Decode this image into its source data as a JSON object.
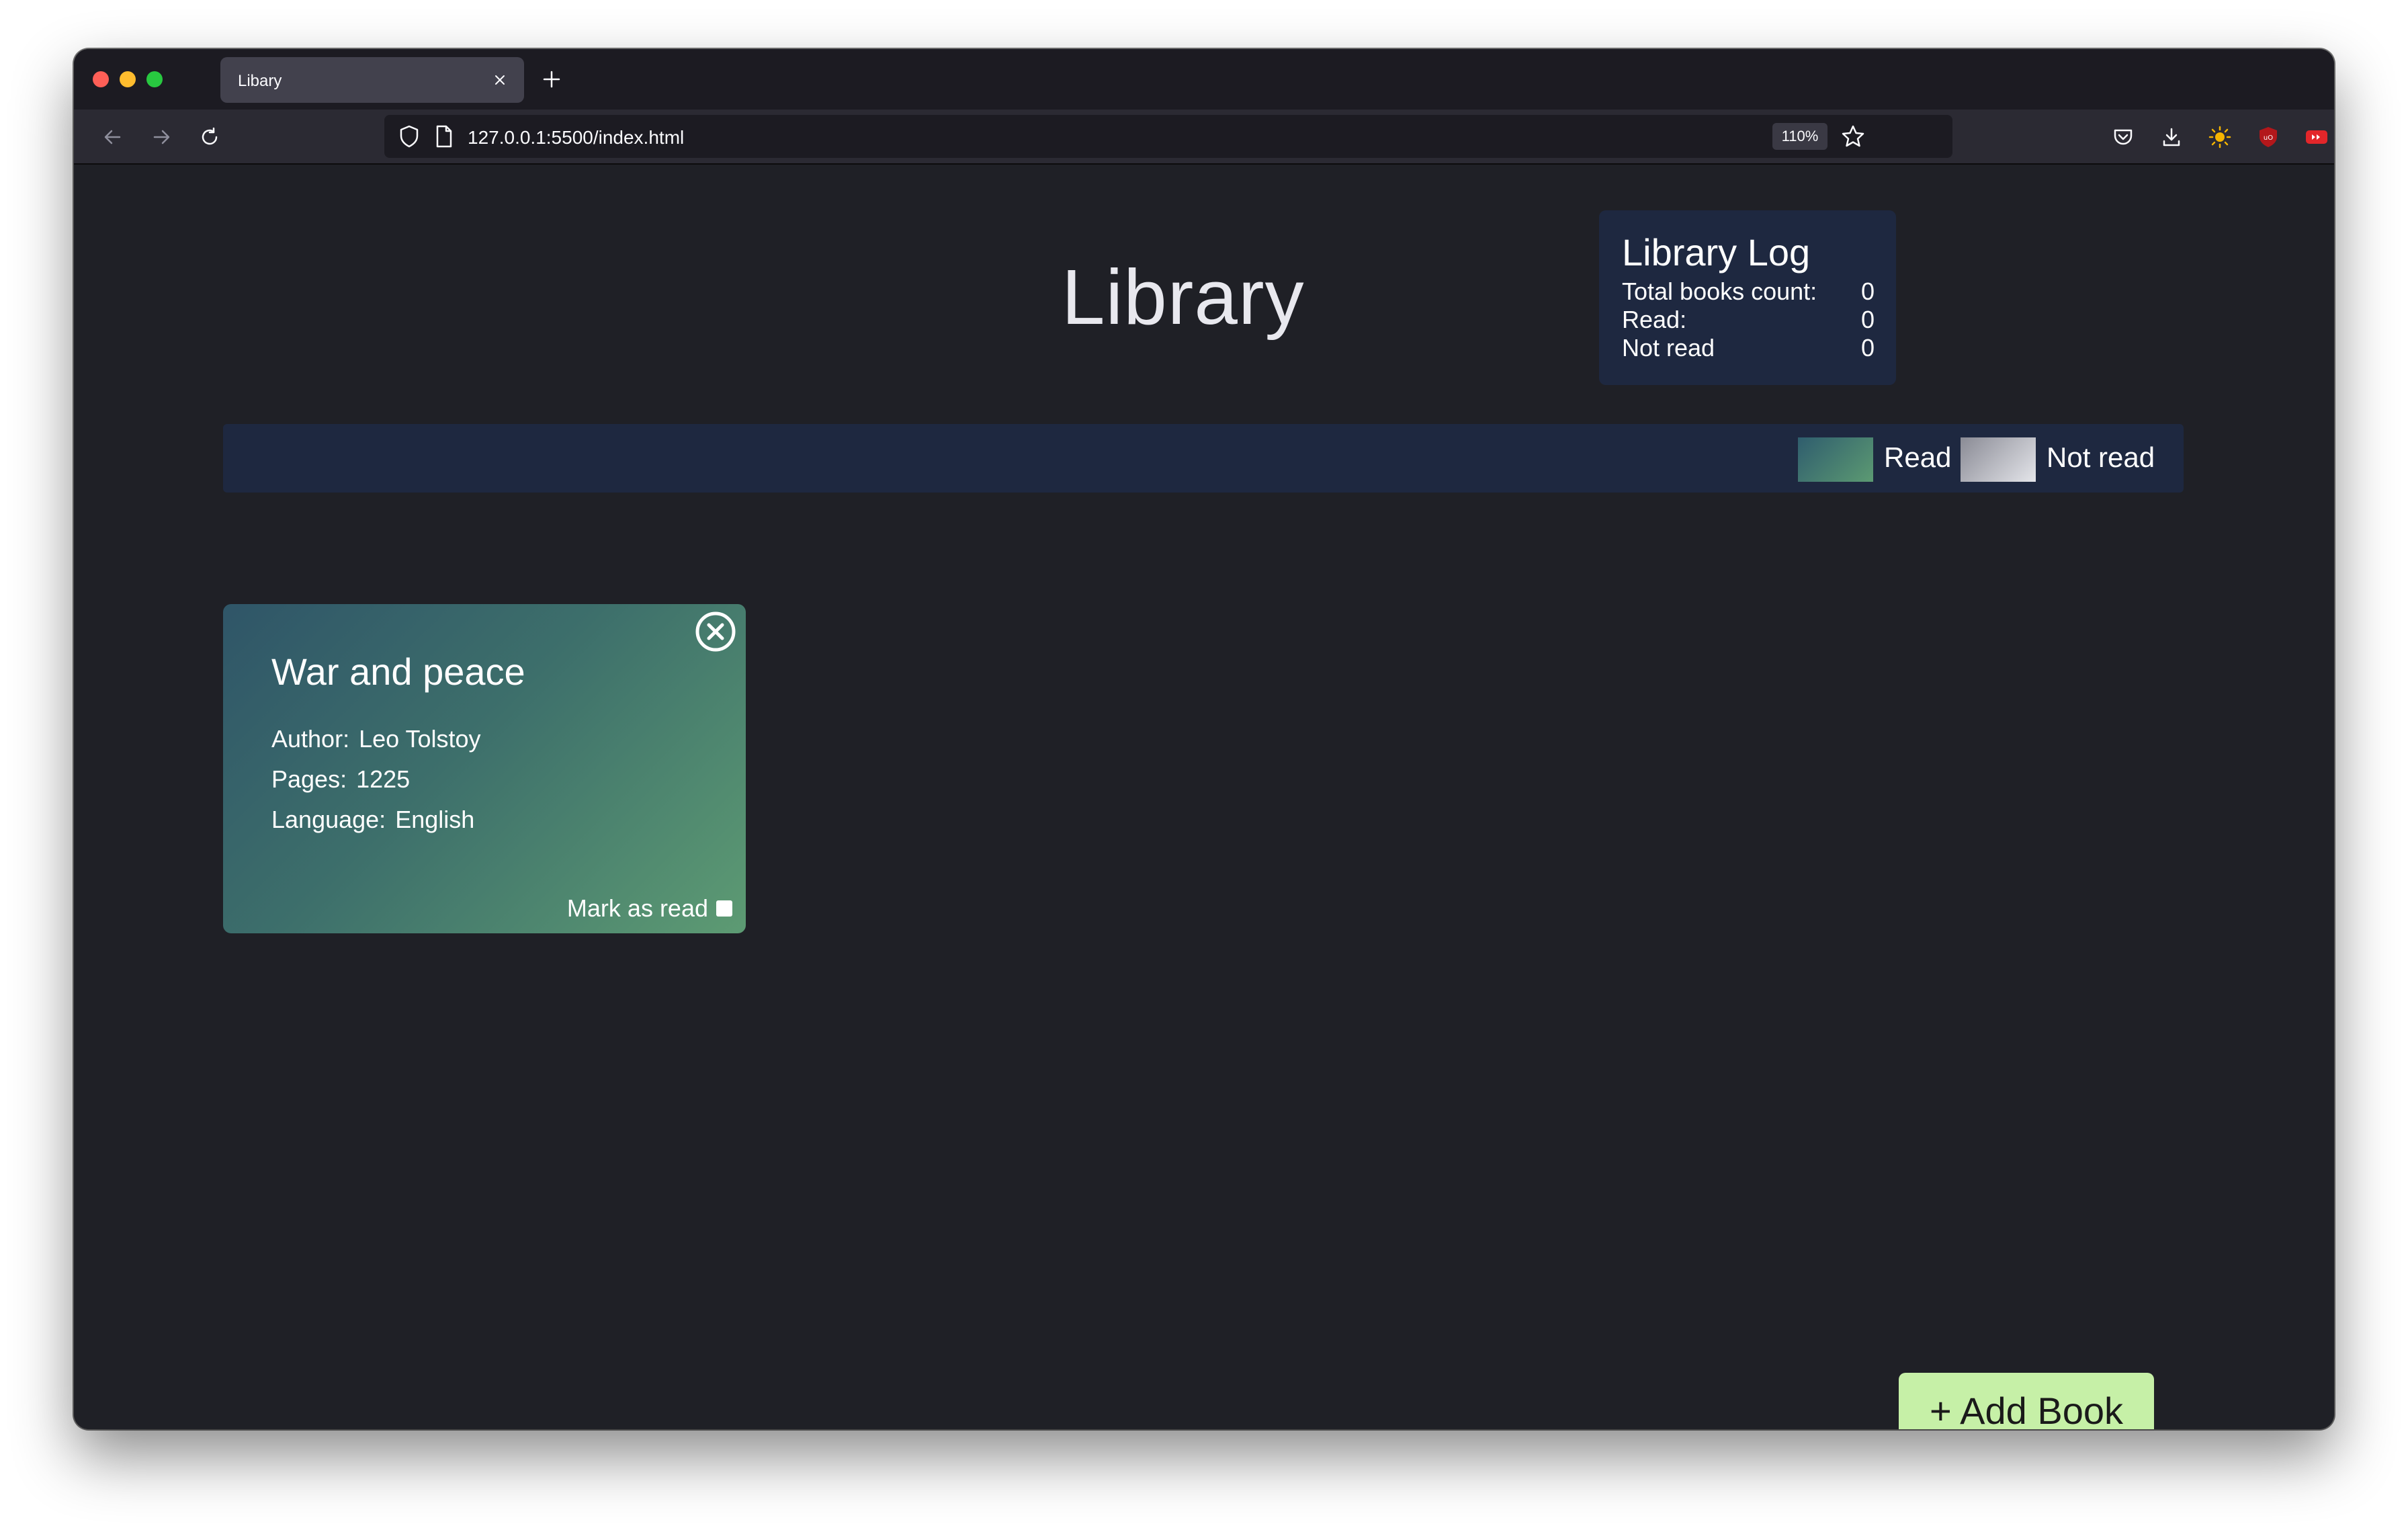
{
  "browser": {
    "tab_title": "Libary",
    "url": "127.0.0.1:5500/index.html",
    "zoom": "110%"
  },
  "page": {
    "title": "Library",
    "library_log": {
      "title": "Library Log",
      "rows": [
        {
          "label": "Total books count:",
          "value": "0"
        },
        {
          "label": "Read:",
          "value": "0"
        },
        {
          "label": "Not read",
          "value": "0"
        }
      ]
    },
    "legend": {
      "read_label": "Read",
      "not_read_label": "Not read"
    },
    "books": [
      {
        "title": "War and peace",
        "author_label": "Author:",
        "author": "Leo Tolstoy",
        "pages_label": "Pages:",
        "pages": "1225",
        "language_label": "Language:",
        "language": "English",
        "mark_label": "Mark as read",
        "read": false
      }
    ],
    "add_book_label": "+ Add Book"
  },
  "colors": {
    "background": "#1f2026",
    "panel": "#1e2840",
    "add_button": "#c6f0a7",
    "read_gradient": [
      "#2f5568",
      "#5d9b73"
    ],
    "not_read_gradient": [
      "#8a8b95",
      "#e4e5ea"
    ]
  },
  "icons": [
    "back-arrow-icon",
    "forward-arrow-icon",
    "reload-icon",
    "shield-icon",
    "page-icon",
    "star-icon",
    "pocket-icon",
    "download-icon",
    "sun-icon",
    "ublock-icon",
    "youtube-icon",
    "menu-icon",
    "close-icon",
    "plus-icon",
    "circle-x-icon"
  ]
}
